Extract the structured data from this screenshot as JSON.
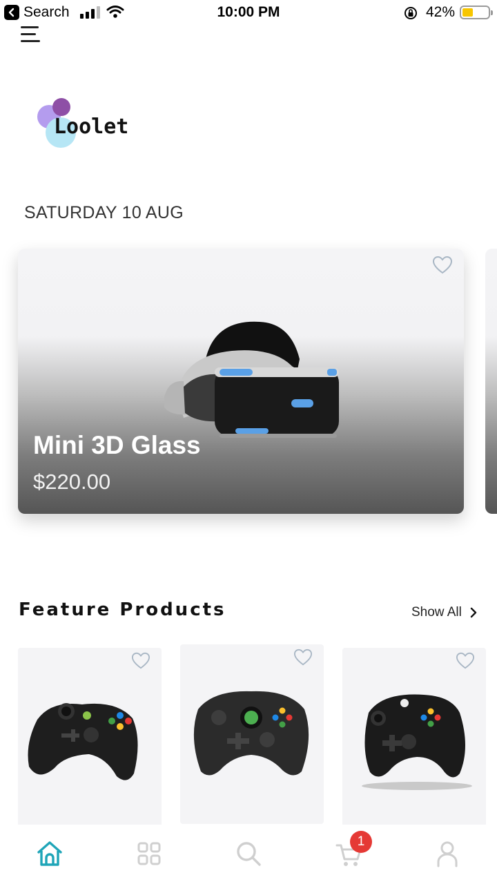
{
  "status_bar": {
    "back_app": "Search",
    "time": "10:00 PM",
    "battery_percent": "42%",
    "battery_level": 0.42,
    "battery_color": "#f7c600"
  },
  "header": {
    "menu_icon": "hamburger-menu-icon",
    "logo_text": "Loolet",
    "logo_colors": [
      "#b49cee",
      "#8e4fa6",
      "#b6e6f5"
    ]
  },
  "date_label": "SATURDAY 10 AUG",
  "hero": {
    "title": "Mini 3D Glass",
    "price": "$220.00",
    "favorite_icon": "heart-outline-icon",
    "image": "vr-headset"
  },
  "feature": {
    "title": "Feature Products",
    "show_all": "Show All",
    "show_all_icon": "chevron-right-icon",
    "products": [
      {
        "image": "xbox-360-controller",
        "favorite_icon": "heart-outline-icon"
      },
      {
        "image": "xbox-duke-controller",
        "favorite_icon": "heart-outline-icon"
      },
      {
        "image": "xbox-one-controller",
        "favorite_icon": "heart-outline-icon"
      }
    ]
  },
  "bottom_nav": {
    "items": [
      {
        "name": "home",
        "icon": "home-icon",
        "active": true
      },
      {
        "name": "categories",
        "icon": "grid-icon",
        "active": false
      },
      {
        "name": "search",
        "icon": "search-icon",
        "active": false
      },
      {
        "name": "cart",
        "icon": "cart-icon",
        "active": false
      },
      {
        "name": "profile",
        "icon": "user-icon",
        "active": false
      }
    ],
    "cart_badge": "1",
    "active_color": "#1fa5b8",
    "inactive_color": "#cfcfcf",
    "badge_color": "#e53935"
  }
}
